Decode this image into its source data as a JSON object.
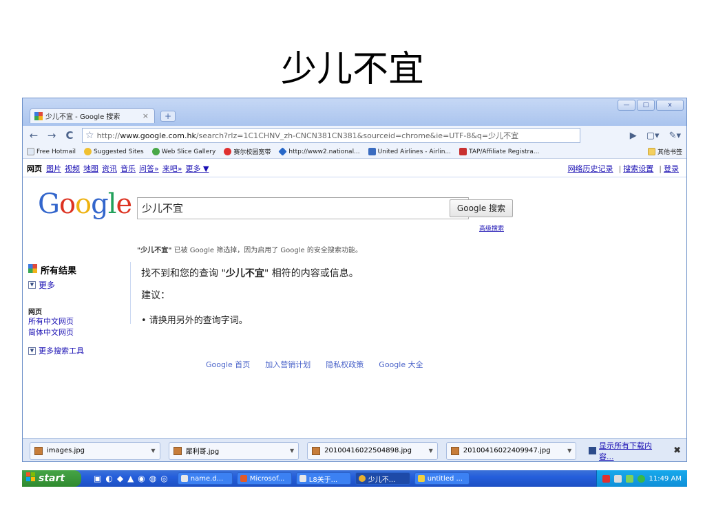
{
  "slide": {
    "title": "少儿不宜"
  },
  "browser": {
    "tab_title": "少儿不宜 - Google 搜索",
    "tab_close": "×",
    "newtab": "+",
    "controls": {
      "min": "—",
      "max": "□",
      "close": "x"
    },
    "nav": {
      "back": "←",
      "forward": "→",
      "reload": "C",
      "star": "☆"
    },
    "url_scheme": "http://",
    "url_domain": "www.google.com.hk",
    "url_rest": "/search?rlz=1C1CHNV_zh-CNCN381CN381&sourceid=chrome&ie=UTF-8&q=少儿不宜",
    "go": "▶",
    "page_menu": "▢▾",
    "wrench": "✎▾"
  },
  "bookmarks": [
    {
      "label": "Free Hotmail",
      "color": "#dfe8f5"
    },
    {
      "label": "Suggested Sites",
      "color": "#f0c030"
    },
    {
      "label": "Web Slice Gallery",
      "color": "#49a848"
    },
    {
      "label": "赛尔校园宽带",
      "color": "#e03030"
    },
    {
      "label": "http://www2.national...",
      "color": "#2868c8"
    },
    {
      "label": "United Airlines - Airlin...",
      "color": "#3a6cc0"
    },
    {
      "label": "TAP/Affiliate Registra...",
      "color": "#c83030"
    }
  ],
  "bookmarks_other": "其他书签",
  "gbar": {
    "current": "网页",
    "links": [
      "图片",
      "视频",
      "地图",
      "资讯",
      "音乐",
      "问答»",
      "来吧»",
      "更多 ▼"
    ],
    "right": [
      "网络历史记录",
      "搜索设置",
      "登录"
    ]
  },
  "google": {
    "logo": [
      "G",
      "o",
      "o",
      "g",
      "l",
      "e"
    ],
    "logo_colors": [
      "#3366cc",
      "#dd3322",
      "#eeb211",
      "#3366cc",
      "#22a15b",
      "#dd3322"
    ],
    "query": "少儿不宜",
    "search_button": "Google 搜索",
    "advanced": "高级搜索",
    "safe_term": "\"少儿不宜\"",
    "safe_text": " 已被 Google 筛选掉，因为启用了 Google 的安全搜索功能。"
  },
  "sidebar": {
    "all_results": "所有结果",
    "more": "更多",
    "section": "网页",
    "links": [
      "所有中文网页",
      "简体中文网页"
    ],
    "tools": "更多搜索工具"
  },
  "results": {
    "prefix": "找不到和您的查询 \"",
    "term": "少儿不宜",
    "suffix": "\" 相符的内容或信息。",
    "suggest_label": "建议：",
    "suggestion": "• 请换用另外的查询字词。"
  },
  "footer": [
    "Google 首页",
    "加入营销计划",
    "隐私权政策",
    "Google 大全"
  ],
  "downloads": {
    "items": [
      "images.jpg",
      "犀利哥.jpg",
      "20100416022504898.jpg",
      "20100416022409947.jpg"
    ],
    "show_all": "显示所有下载内容...",
    "close": "✖"
  },
  "taskbar": {
    "start": "start",
    "quick_launch": [
      "▣",
      "◐",
      "◆",
      "▲",
      "◉",
      "◍",
      "◎"
    ],
    "tasks": [
      "name.d...",
      "Microsof...",
      "L8关于...",
      "少儿不...",
      "untitled ..."
    ],
    "tasks_active_index": 3,
    "clock": "11:49 AM"
  }
}
